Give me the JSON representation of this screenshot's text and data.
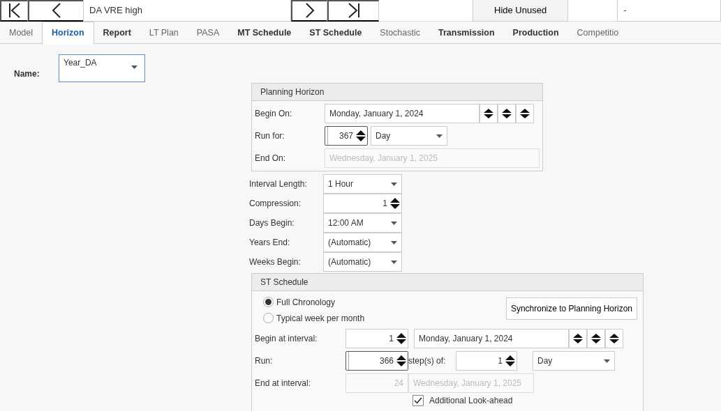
{
  "toolbar": {
    "record_field": "DA VRE high",
    "hide_button": "Hide Unused",
    "filter_field": "-"
  },
  "tabs": [
    {
      "label": "Model",
      "selected": false,
      "bold": false
    },
    {
      "label": "Horizon",
      "selected": true,
      "bold": true
    },
    {
      "label": "Report",
      "selected": false,
      "bold": true
    },
    {
      "label": "LT Plan",
      "selected": false,
      "bold": false
    },
    {
      "label": "PASA",
      "selected": false,
      "bold": false
    },
    {
      "label": "MT Schedule",
      "selected": false,
      "bold": true
    },
    {
      "label": "ST Schedule",
      "selected": false,
      "bold": true
    },
    {
      "label": "Stochastic",
      "selected": false,
      "bold": false
    },
    {
      "label": "Transmission",
      "selected": false,
      "bold": true
    },
    {
      "label": "Production",
      "selected": false,
      "bold": true
    },
    {
      "label": "Competitio",
      "selected": false,
      "bold": false
    }
  ],
  "name": {
    "label": "Name:",
    "value": "Year_DA"
  },
  "planning_horizon": {
    "title": "Planning Horizon",
    "begin_label": "Begin On:",
    "begin_value": "Monday, January 1, 2024",
    "run_label": "Run for:",
    "run_value": "367",
    "run_focused": true,
    "run_unit": "Day",
    "end_label": "End On:",
    "end_value": "Wednesday, January 1, 2025"
  },
  "settings": [
    {
      "kind": "select",
      "label": "Interval Length:",
      "value": "1 Hour"
    },
    {
      "kind": "spin",
      "label": "Compression:",
      "value": "1"
    },
    {
      "kind": "select",
      "label": "Days Begin:",
      "value": "12:00 AM"
    },
    {
      "kind": "select",
      "label": "Years End:",
      "value": "(Automatic)"
    },
    {
      "kind": "select",
      "label": "Weeks Begin:",
      "value": "(Automatic)"
    }
  ],
  "st_schedule": {
    "title": "ST Schedule",
    "options": [
      {
        "label": "Full Chronology",
        "selected": true
      },
      {
        "label": "Typical week per month",
        "selected": false
      }
    ],
    "sync_button": "Synchronize to Planning Horizon",
    "begin_label": "Begin at interval:",
    "begin_interval": "1",
    "begin_date": "Monday, January 1, 2024",
    "run_label": "Run:",
    "run_value": "366",
    "run_focused": true,
    "steps_label": "step(s) of:",
    "step_value": "1",
    "step_unit": "Day",
    "end_label": "End at interval:",
    "end_interval": "24",
    "end_date": "Wednesday, January 1, 2025",
    "lookahead": {
      "label": "Additional Look-ahead",
      "checked": true
    }
  }
}
